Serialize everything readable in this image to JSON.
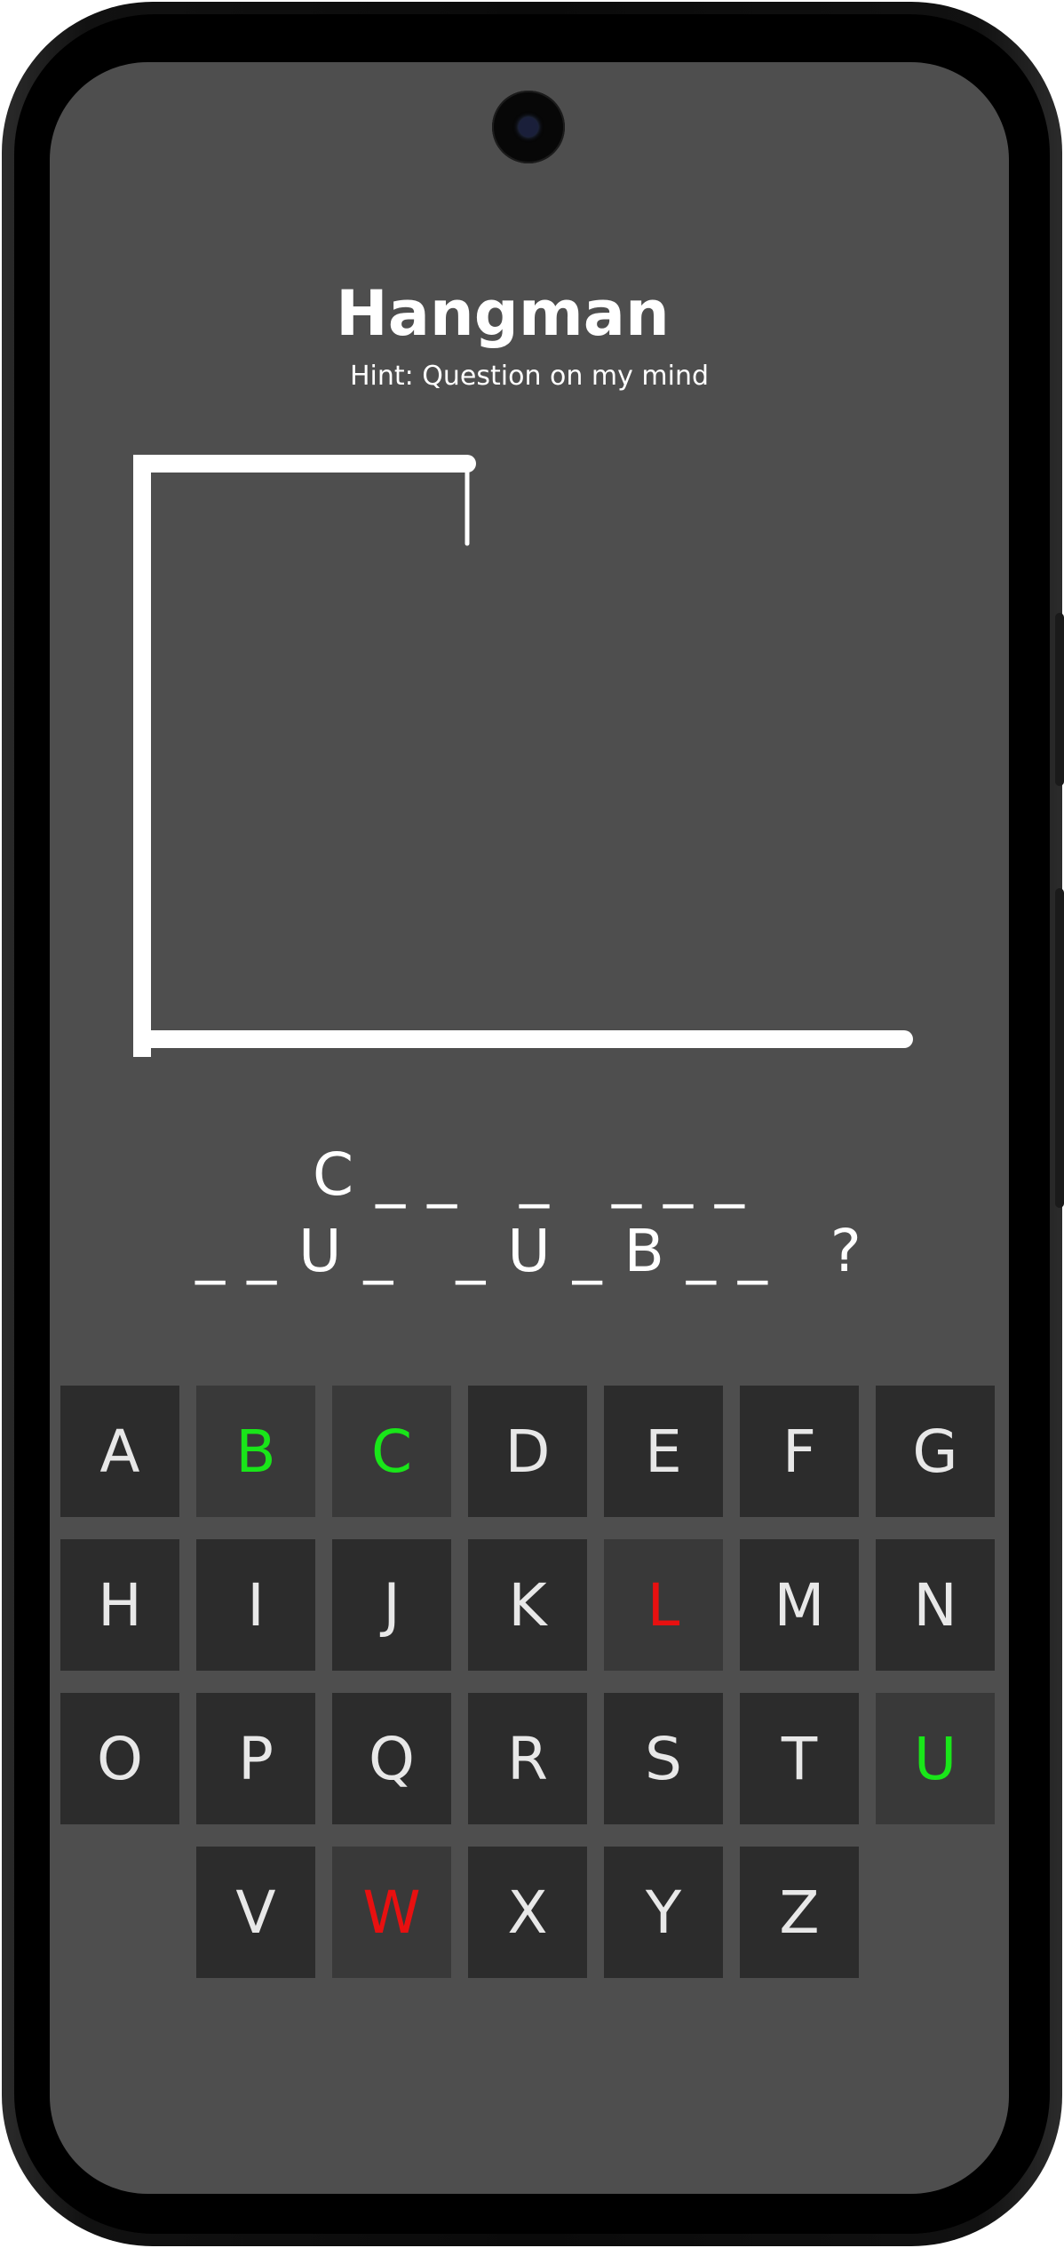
{
  "app": {
    "title": "Hangman",
    "hint": "Hint: Question on my mind"
  },
  "puzzle": {
    "line1": "C _ _   _   _ _ _",
    "line2": "_ _ U _   _ U _ B _ _   ?"
  },
  "keyboard": {
    "rows": [
      [
        "A",
        "B",
        "C",
        "D",
        "E",
        "F",
        "G"
      ],
      [
        "H",
        "I",
        "J",
        "K",
        "L",
        "M",
        "N"
      ],
      [
        "O",
        "P",
        "Q",
        "R",
        "S",
        "T",
        "U"
      ],
      [
        "V",
        "W",
        "X",
        "Y",
        "Z"
      ]
    ],
    "correct": [
      "B",
      "C",
      "U"
    ],
    "wrong": [
      "L",
      "W"
    ]
  },
  "colors": {
    "background": "#4e4e4e",
    "key": "#2c2c2c",
    "key_used": "#393939",
    "correct": "#19e619",
    "wrong": "#e81010",
    "text": "#ffffff"
  }
}
